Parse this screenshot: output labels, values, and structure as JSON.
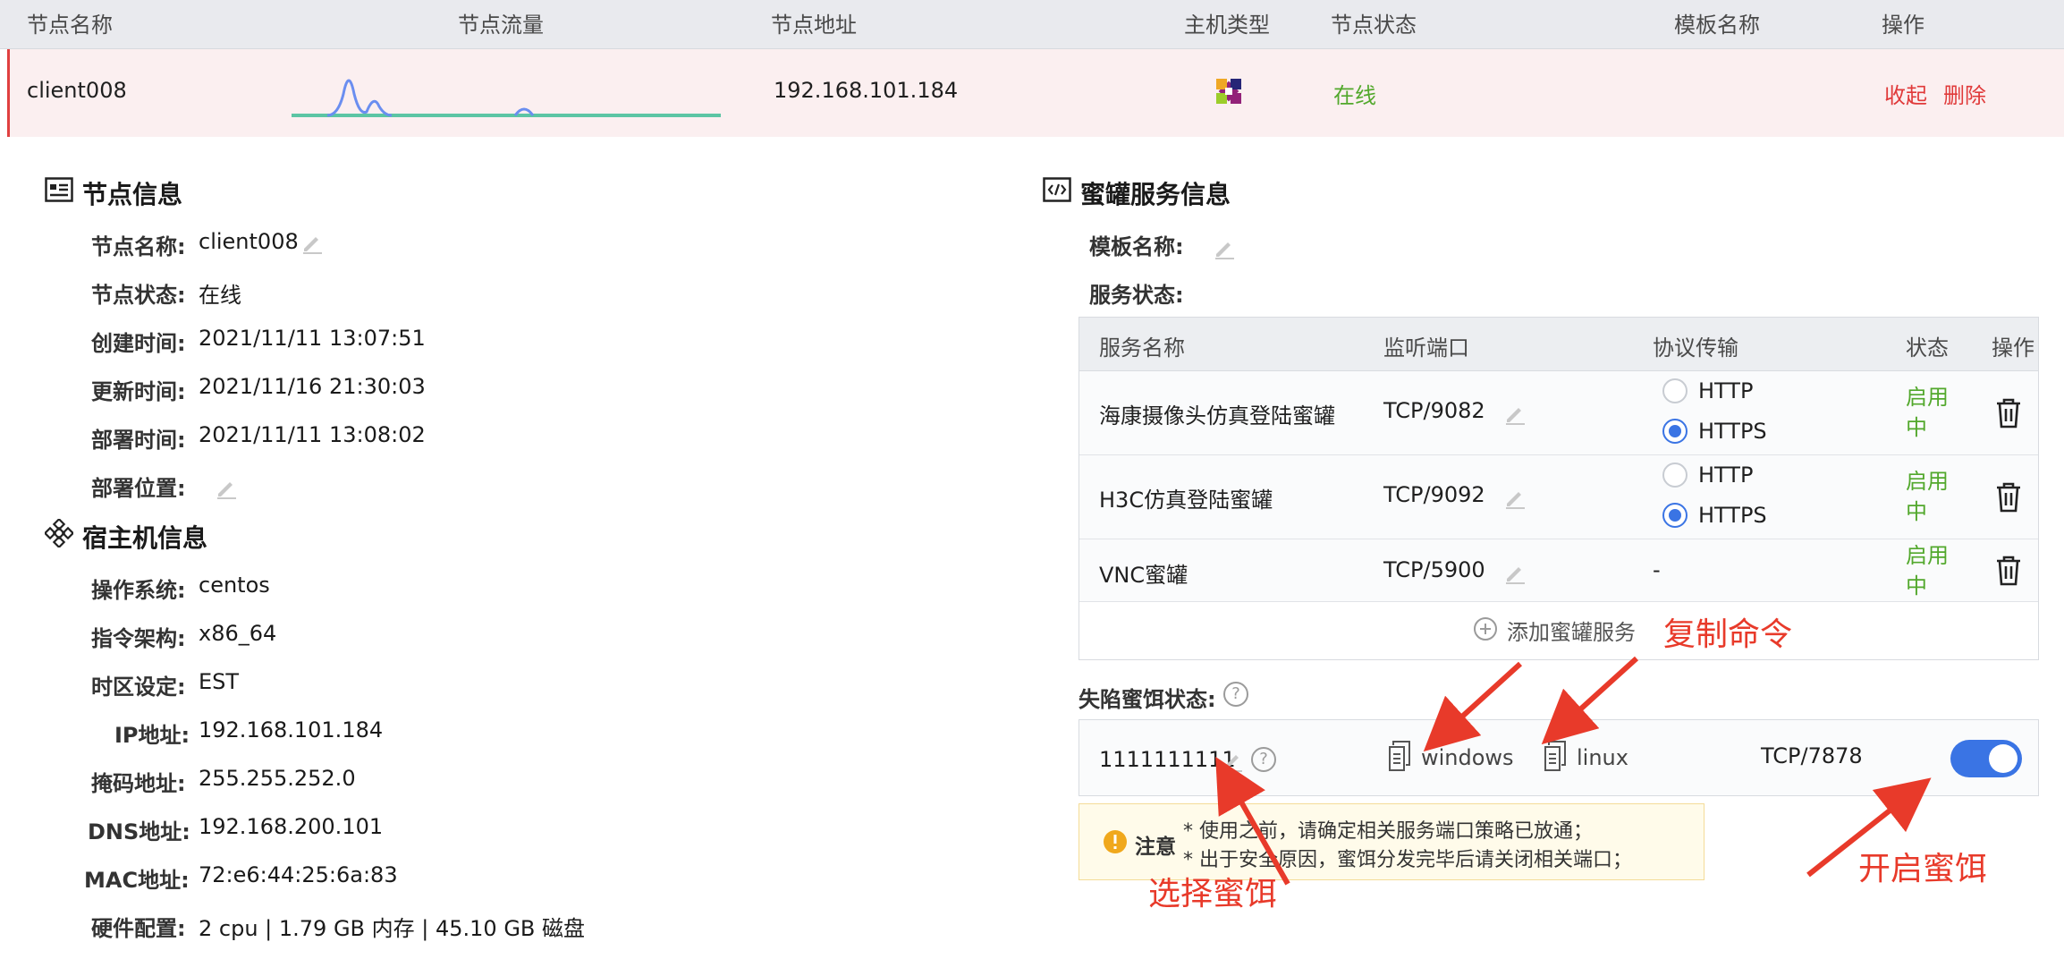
{
  "table": {
    "headers": [
      "节点名称",
      "节点流量",
      "节点地址",
      "主机类型",
      "节点状态",
      "模板名称",
      "操作"
    ],
    "row": {
      "name": "client008",
      "address": "192.168.101.184",
      "host_type_icon": "centos-logo-icon",
      "status": "在线",
      "template": "",
      "actions": [
        "收起",
        "删除"
      ]
    }
  },
  "node_info": {
    "title": "节点信息",
    "fields": [
      {
        "label": "节点名称:",
        "value": "client008"
      },
      {
        "label": "节点状态:",
        "value": "在线"
      },
      {
        "label": "创建时间:",
        "value": "2021/11/11 13:07:51"
      },
      {
        "label": "更新时间:",
        "value": "2021/11/16 21:30:03"
      },
      {
        "label": "部署时间:",
        "value": "2021/11/11 13:08:02"
      },
      {
        "label": "部署位置:",
        "value": ""
      }
    ]
  },
  "host_info": {
    "title": "宿主机信息",
    "fields": [
      {
        "label": "操作系统:",
        "value": "centos"
      },
      {
        "label": "指令架构:",
        "value": "x86_64"
      },
      {
        "label": "时区设定:",
        "value": "EST"
      },
      {
        "label": "IP地址:",
        "value": "192.168.101.184"
      },
      {
        "label": "掩码地址:",
        "value": "255.255.252.0"
      },
      {
        "label": "DNS地址:",
        "value": "192.168.200.101"
      },
      {
        "label": "MAC地址:",
        "value": "72:e6:44:25:6a:83"
      },
      {
        "label": "硬件配置:",
        "value": "2 cpu | 1.79 GB 内存 | 45.10 GB 磁盘"
      }
    ]
  },
  "honeypot": {
    "title": "蜜罐服务信息",
    "template_label": "模板名称:",
    "template_value": "",
    "service_status_label": "服务状态:",
    "columns": [
      "服务名称",
      "监听端口",
      "协议传输",
      "状态",
      "操作"
    ],
    "services": [
      {
        "name": "海康摄像头仿真登陆蜜罐",
        "port": "TCP/9082",
        "protocols": [
          "HTTP",
          "HTTPS"
        ],
        "selected": "HTTPS",
        "status": "启用中"
      },
      {
        "name": "H3C仿真登陆蜜罐",
        "port": "TCP/9092",
        "protocols": [
          "HTTP",
          "HTTPS"
        ],
        "selected": "HTTPS",
        "status": "启用中"
      },
      {
        "name": "VNC蜜罐",
        "port": "TCP/5900",
        "protocols": "-",
        "status": "启用中"
      }
    ],
    "add_service": "添加蜜罐服务"
  },
  "bait": {
    "label": "失陷蜜饵状态:",
    "name": "1111111111",
    "copy_windows": "windows",
    "copy_linux": "linux",
    "port": "TCP/7878",
    "enabled": true
  },
  "notice": {
    "title": "注意",
    "lines": [
      "* 使用之前，请确定相关服务端口策略已放通；",
      "* 出于安全原因，蜜饵分发完毕后请关闭相关端口；"
    ]
  },
  "annotations": {
    "copy_command": "复制命令",
    "select_bait": "选择蜜饵",
    "enable_bait": "开启蜜饵"
  },
  "colors": {
    "online_green": "#52a82c",
    "danger_red": "#e03a3a",
    "accent_blue": "#3a74e4",
    "annotation_red": "#e83a2a"
  }
}
